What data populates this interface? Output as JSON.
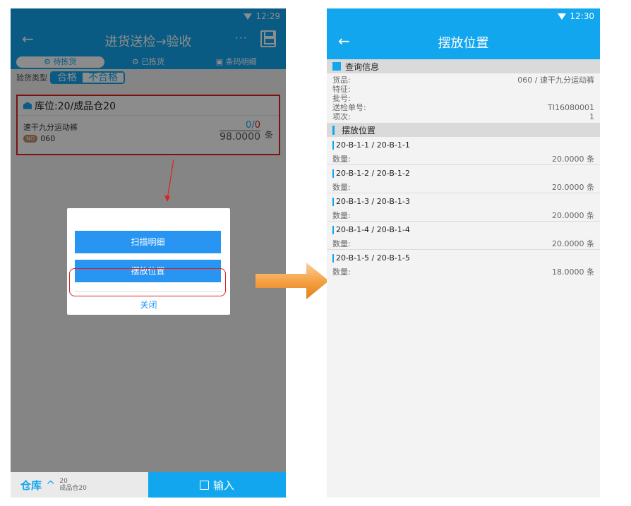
{
  "left": {
    "time": "12:29",
    "title": "进货送检→验收",
    "more": "···",
    "tabs": [
      "待拣货",
      "已拣货",
      "条码明细"
    ],
    "type_label": "验货类型",
    "seg_on": "合格",
    "seg_off": "不合格",
    "card": {
      "location": "库位:20/成品仓20",
      "item_name": "速干九分运动裤",
      "no_badge": "NO",
      "item_no": "060",
      "qty_done": "0",
      "qty_sep": "/",
      "qty_scan": "0",
      "qty_total": "98.0000",
      "unit": "条"
    },
    "dialog": {
      "btn_scan": "扫描明细",
      "btn_position": "摆放位置",
      "close": "关闭"
    },
    "bottom": {
      "warehouse_label": "仓库",
      "warehouse_code": "20",
      "warehouse_name": "成品仓20",
      "input": "输入"
    }
  },
  "right": {
    "time": "12:30",
    "title": "摆放位置",
    "query_title": "查询信息",
    "info": [
      {
        "label": "货品:",
        "value": "060 / 速干九分运动裤"
      },
      {
        "label": "特征:",
        "value": ""
      },
      {
        "label": "批号:",
        "value": ""
      },
      {
        "label": "送检单号:",
        "value": "TI16080001"
      },
      {
        "label": "项次:",
        "value": "1"
      }
    ],
    "position_title": "摆放位置",
    "qty_label": "数量:",
    "positions": [
      {
        "code": "20-B-1-1 / 20-B-1-1",
        "qty": "20.0000 条"
      },
      {
        "code": "20-B-1-2 / 20-B-1-2",
        "qty": "20.0000 条"
      },
      {
        "code": "20-B-1-3 / 20-B-1-3",
        "qty": "20.0000 条"
      },
      {
        "code": "20-B-1-4 / 20-B-1-4",
        "qty": "20.0000 条"
      },
      {
        "code": "20-B-1-5 / 20-B-1-5",
        "qty": "18.0000 条"
      }
    ]
  },
  "colors": {
    "primary": "#12a6ee",
    "dialog_button": "#2895f2",
    "highlight": "#e02020",
    "arrow": "#f5a244"
  }
}
